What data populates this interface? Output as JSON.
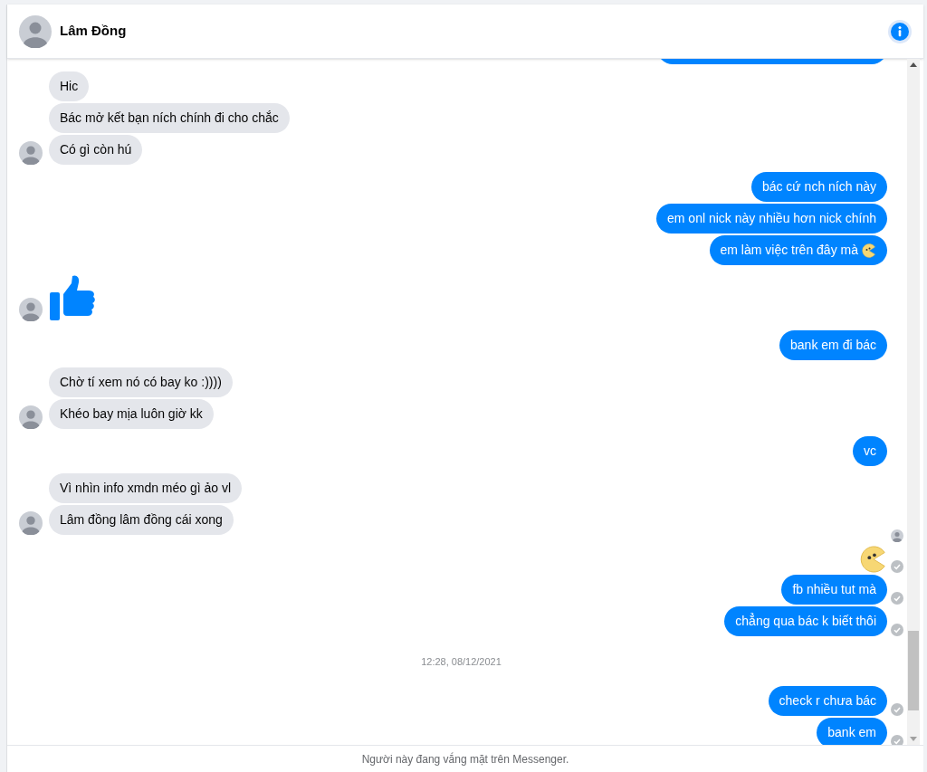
{
  "header": {
    "name": "Lâm Đồng"
  },
  "messages": [
    {
      "kind": "incoming",
      "bubbles": [
        {
          "text": "Hic"
        },
        {
          "text": "Bác mở kết bạn ních chính đi cho chắc"
        },
        {
          "text": "Có gì còn hú"
        }
      ]
    },
    {
      "kind": "outgoing",
      "bubbles": [
        {
          "kind": "text",
          "text": "bác cứ nch ních này",
          "seen": false
        },
        {
          "kind": "text",
          "text": "em onl nick này nhiều hơn nick chính",
          "seen": false
        },
        {
          "kind": "text",
          "text": "em làm việc trên đây mà",
          "seen": false,
          "emoji": true
        }
      ]
    },
    {
      "kind": "like"
    },
    {
      "kind": "outgoing",
      "bubbles": [
        {
          "kind": "text",
          "text": "bank em đi bác",
          "seen": false
        }
      ]
    },
    {
      "kind": "incoming",
      "bubbles": [
        {
          "text": "Chờ tí xem nó có bay ko :))))"
        },
        {
          "text": "Khéo bay mịa luôn giờ kk"
        }
      ]
    },
    {
      "kind": "outgoing",
      "bubbles": [
        {
          "kind": "text",
          "text": "vc",
          "seen": false
        }
      ]
    },
    {
      "kind": "incoming",
      "bubbles": [
        {
          "text": "Vì nhìn info xmdn méo gì ảo vl"
        },
        {
          "text": "Lâm đồng lâm đồng cái xong"
        }
      ]
    },
    {
      "kind": "read-receipt"
    },
    {
      "kind": "outgoing",
      "bubbles": [
        {
          "kind": "sticker",
          "seen": true
        },
        {
          "kind": "text",
          "text": "fb nhiều tut mà",
          "seen": true
        },
        {
          "kind": "text",
          "text": "chẳng qua bác k biết thôi",
          "seen": true
        }
      ]
    },
    {
      "kind": "timestamp",
      "text": "12:28, 08/12/2021"
    },
    {
      "kind": "outgoing",
      "bubbles": [
        {
          "kind": "text",
          "text": "check r chưa bác",
          "seen": true
        },
        {
          "kind": "text",
          "text": "bank em",
          "seen": true
        }
      ]
    }
  ],
  "footer": {
    "text": "Người này đang vắng mặt trên Messenger."
  }
}
